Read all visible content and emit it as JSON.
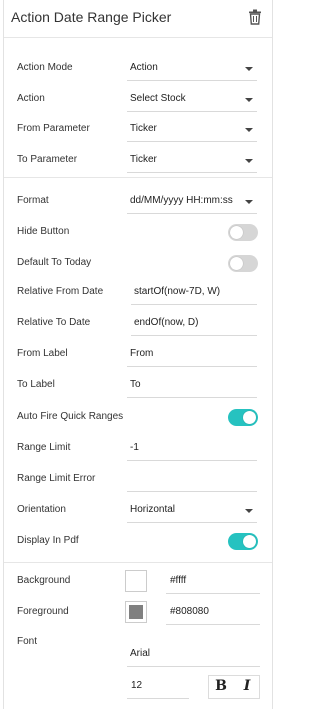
{
  "panel": {
    "title": "Action Date Range Picker",
    "delete_icon": "trash-icon"
  },
  "action_section": {
    "action_mode": {
      "label": "Action Mode",
      "value": "Action"
    },
    "action": {
      "label": "Action",
      "value": "Select Stock"
    },
    "from_parameter": {
      "label": "From Parameter",
      "value": "Ticker"
    },
    "to_parameter": {
      "label": "To Parameter",
      "value": "Ticker"
    }
  },
  "settings_section": {
    "format": {
      "label": "Format",
      "value": "dd/MM/yyyy HH:mm:ss"
    },
    "hide_button": {
      "label": "Hide Button",
      "on": false
    },
    "default_to_today": {
      "label": "Default To Today",
      "on": false
    },
    "relative_from_date": {
      "label": "Relative From Date",
      "value": "startOf(now-7D, W)"
    },
    "relative_to_date": {
      "label": "Relative To Date",
      "value": "endOf(now, D)"
    },
    "from_label": {
      "label": "From Label",
      "value": "From"
    },
    "to_label": {
      "label": "To Label",
      "value": "To"
    },
    "auto_fire_quick_ranges": {
      "label": "Auto Fire Quick Ranges",
      "on": true
    },
    "range_limit": {
      "label": "Range Limit",
      "value": "-1"
    },
    "range_limit_error": {
      "label": "Range Limit Error",
      "value": ""
    },
    "orientation": {
      "label": "Orientation",
      "value": "Horizontal"
    },
    "display_in_pdf": {
      "label": "Display In Pdf",
      "on": true
    }
  },
  "style_section": {
    "background": {
      "label": "Background",
      "value": "#ffff",
      "swatch": "#ffffff"
    },
    "foreground": {
      "label": "Foreground",
      "value": "#808080",
      "swatch": "#808080"
    },
    "font": {
      "label": "Font",
      "value": "Arial"
    },
    "font_size": {
      "value": "12"
    },
    "bold_label": "B",
    "italic_label": "I"
  },
  "colors": {
    "toggle_on": "#26c2c0",
    "toggle_off": "#d6d6d6"
  }
}
